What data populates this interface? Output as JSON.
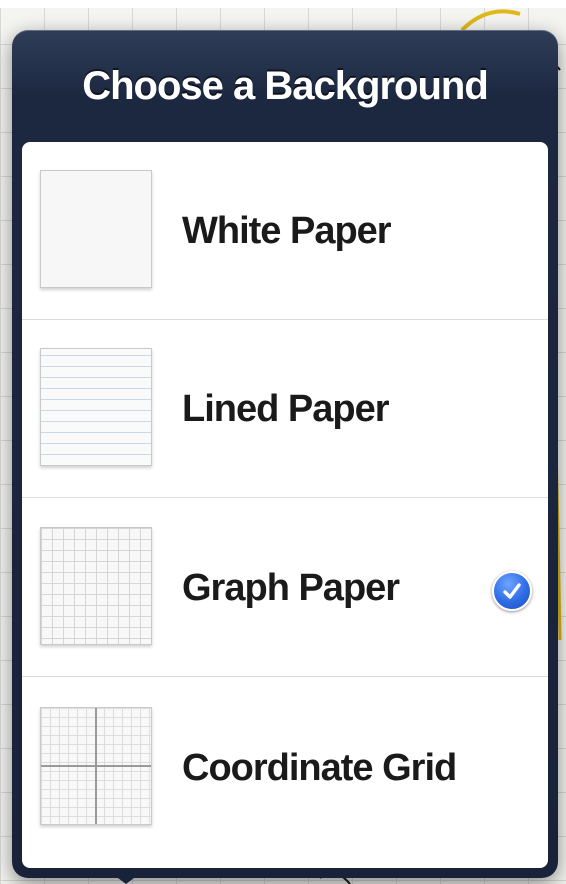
{
  "popover": {
    "title": "Choose a Background"
  },
  "options": [
    {
      "label": "White Paper",
      "thumbnail": "white-paper-thumbnail",
      "selected": false
    },
    {
      "label": "Lined Paper",
      "thumbnail": "lined-paper-thumbnail",
      "selected": false
    },
    {
      "label": "Graph Paper",
      "thumbnail": "graph-paper-thumbnail",
      "selected": true
    },
    {
      "label": "Coordinate Grid",
      "thumbnail": "coordinate-grid-thumbnail",
      "selected": false
    }
  ],
  "icons": {
    "selected": "checkmark-icon"
  },
  "colors": {
    "popover_header": "#1c2840",
    "check_accent": "#2e6ce6",
    "list_background": "#ffffff"
  }
}
